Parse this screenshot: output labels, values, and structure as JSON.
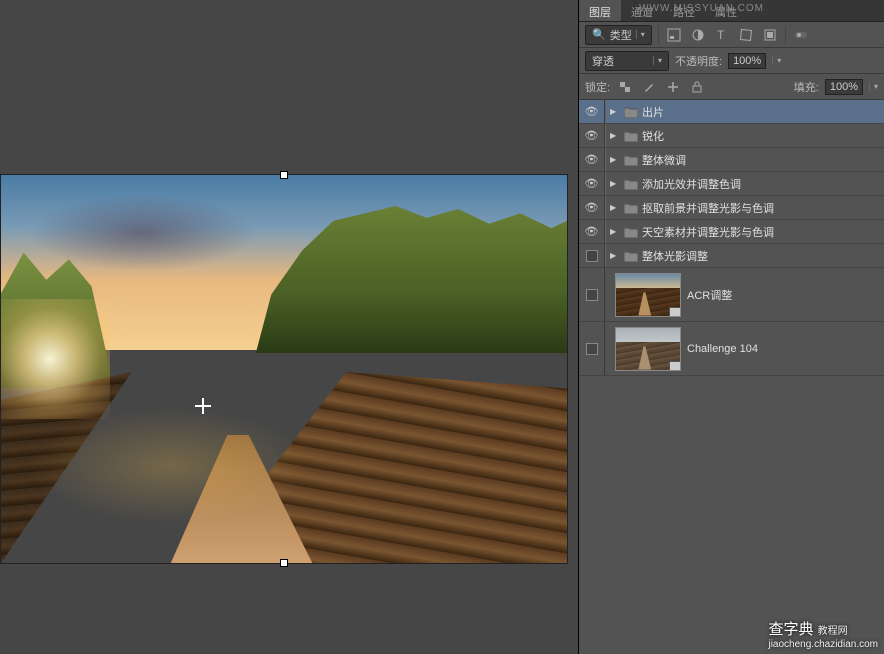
{
  "panel_tabs": {
    "layers": "图层",
    "channels": "通道",
    "paths": "路径",
    "properties": "属性"
  },
  "filter_row": {
    "kind_label": "类型"
  },
  "blend_row": {
    "mode": "穿透",
    "opacity_label": "不透明度:",
    "opacity_value": "100%"
  },
  "lock_row": {
    "lock_label": "锁定:",
    "fill_label": "填充:",
    "fill_value": "100%"
  },
  "layers": [
    {
      "name": "出片",
      "selected": true,
      "visible": true
    },
    {
      "name": "锐化",
      "selected": false,
      "visible": true
    },
    {
      "name": "整体微调",
      "selected": false,
      "visible": true
    },
    {
      "name": "添加光效并调整色调",
      "selected": false,
      "visible": true
    },
    {
      "name": "抠取前景并调整光影与色调",
      "selected": false,
      "visible": true
    },
    {
      "name": "天空素材并调整光影与色调",
      "selected": false,
      "visible": true
    },
    {
      "name": "整体光影调整",
      "selected": false,
      "visible": false
    }
  ],
  "thumb_layers": [
    {
      "name": "ACR调整"
    },
    {
      "name": "Challenge 104"
    }
  ],
  "watermark": {
    "main": "查字典",
    "sub": "教程网",
    "url": "jiaocheng.chazidian.com"
  },
  "wm_top": "WWW.MISSYUAN.COM"
}
